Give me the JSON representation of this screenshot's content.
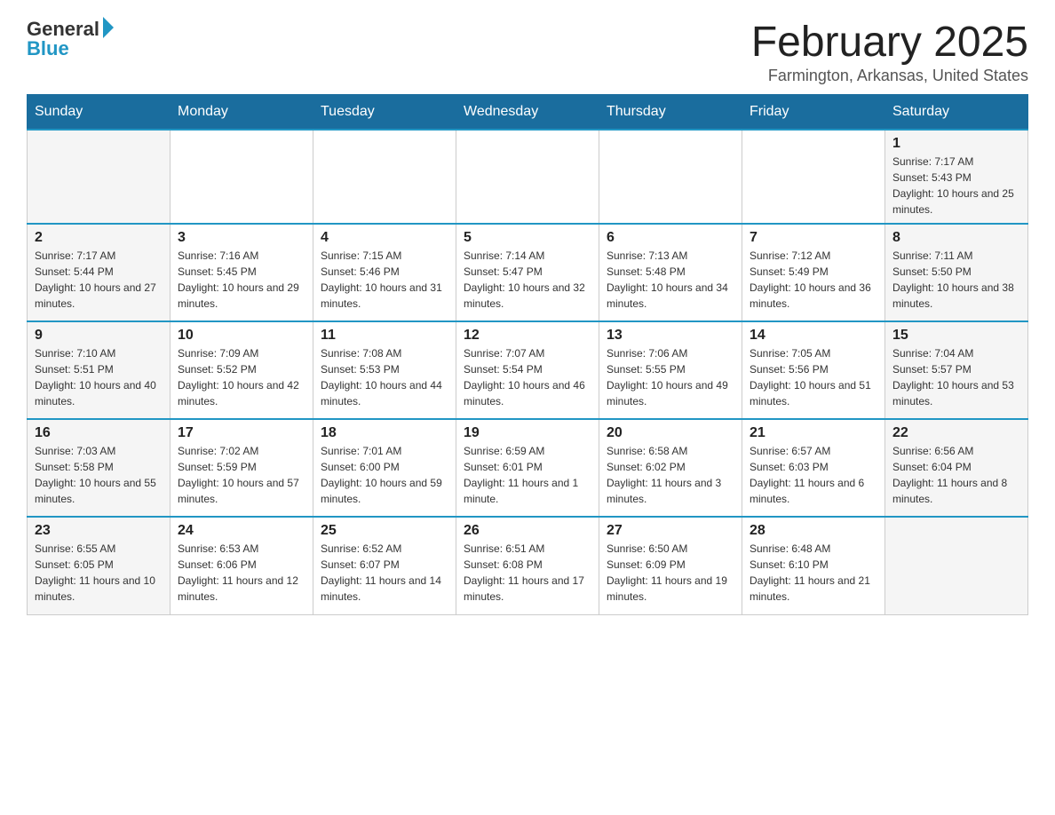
{
  "header": {
    "logo_general": "General",
    "logo_blue": "Blue",
    "month_title": "February 2025",
    "location": "Farmington, Arkansas, United States"
  },
  "days_of_week": [
    "Sunday",
    "Monday",
    "Tuesday",
    "Wednesday",
    "Thursday",
    "Friday",
    "Saturday"
  ],
  "weeks": [
    [
      {
        "day": "",
        "sunrise": "",
        "sunset": "",
        "daylight": ""
      },
      {
        "day": "",
        "sunrise": "",
        "sunset": "",
        "daylight": ""
      },
      {
        "day": "",
        "sunrise": "",
        "sunset": "",
        "daylight": ""
      },
      {
        "day": "",
        "sunrise": "",
        "sunset": "",
        "daylight": ""
      },
      {
        "day": "",
        "sunrise": "",
        "sunset": "",
        "daylight": ""
      },
      {
        "day": "",
        "sunrise": "",
        "sunset": "",
        "daylight": ""
      },
      {
        "day": "1",
        "sunrise": "Sunrise: 7:17 AM",
        "sunset": "Sunset: 5:43 PM",
        "daylight": "Daylight: 10 hours and 25 minutes."
      }
    ],
    [
      {
        "day": "2",
        "sunrise": "Sunrise: 7:17 AM",
        "sunset": "Sunset: 5:44 PM",
        "daylight": "Daylight: 10 hours and 27 minutes."
      },
      {
        "day": "3",
        "sunrise": "Sunrise: 7:16 AM",
        "sunset": "Sunset: 5:45 PM",
        "daylight": "Daylight: 10 hours and 29 minutes."
      },
      {
        "day": "4",
        "sunrise": "Sunrise: 7:15 AM",
        "sunset": "Sunset: 5:46 PM",
        "daylight": "Daylight: 10 hours and 31 minutes."
      },
      {
        "day": "5",
        "sunrise": "Sunrise: 7:14 AM",
        "sunset": "Sunset: 5:47 PM",
        "daylight": "Daylight: 10 hours and 32 minutes."
      },
      {
        "day": "6",
        "sunrise": "Sunrise: 7:13 AM",
        "sunset": "Sunset: 5:48 PM",
        "daylight": "Daylight: 10 hours and 34 minutes."
      },
      {
        "day": "7",
        "sunrise": "Sunrise: 7:12 AM",
        "sunset": "Sunset: 5:49 PM",
        "daylight": "Daylight: 10 hours and 36 minutes."
      },
      {
        "day": "8",
        "sunrise": "Sunrise: 7:11 AM",
        "sunset": "Sunset: 5:50 PM",
        "daylight": "Daylight: 10 hours and 38 minutes."
      }
    ],
    [
      {
        "day": "9",
        "sunrise": "Sunrise: 7:10 AM",
        "sunset": "Sunset: 5:51 PM",
        "daylight": "Daylight: 10 hours and 40 minutes."
      },
      {
        "day": "10",
        "sunrise": "Sunrise: 7:09 AM",
        "sunset": "Sunset: 5:52 PM",
        "daylight": "Daylight: 10 hours and 42 minutes."
      },
      {
        "day": "11",
        "sunrise": "Sunrise: 7:08 AM",
        "sunset": "Sunset: 5:53 PM",
        "daylight": "Daylight: 10 hours and 44 minutes."
      },
      {
        "day": "12",
        "sunrise": "Sunrise: 7:07 AM",
        "sunset": "Sunset: 5:54 PM",
        "daylight": "Daylight: 10 hours and 46 minutes."
      },
      {
        "day": "13",
        "sunrise": "Sunrise: 7:06 AM",
        "sunset": "Sunset: 5:55 PM",
        "daylight": "Daylight: 10 hours and 49 minutes."
      },
      {
        "day": "14",
        "sunrise": "Sunrise: 7:05 AM",
        "sunset": "Sunset: 5:56 PM",
        "daylight": "Daylight: 10 hours and 51 minutes."
      },
      {
        "day": "15",
        "sunrise": "Sunrise: 7:04 AM",
        "sunset": "Sunset: 5:57 PM",
        "daylight": "Daylight: 10 hours and 53 minutes."
      }
    ],
    [
      {
        "day": "16",
        "sunrise": "Sunrise: 7:03 AM",
        "sunset": "Sunset: 5:58 PM",
        "daylight": "Daylight: 10 hours and 55 minutes."
      },
      {
        "day": "17",
        "sunrise": "Sunrise: 7:02 AM",
        "sunset": "Sunset: 5:59 PM",
        "daylight": "Daylight: 10 hours and 57 minutes."
      },
      {
        "day": "18",
        "sunrise": "Sunrise: 7:01 AM",
        "sunset": "Sunset: 6:00 PM",
        "daylight": "Daylight: 10 hours and 59 minutes."
      },
      {
        "day": "19",
        "sunrise": "Sunrise: 6:59 AM",
        "sunset": "Sunset: 6:01 PM",
        "daylight": "Daylight: 11 hours and 1 minute."
      },
      {
        "day": "20",
        "sunrise": "Sunrise: 6:58 AM",
        "sunset": "Sunset: 6:02 PM",
        "daylight": "Daylight: 11 hours and 3 minutes."
      },
      {
        "day": "21",
        "sunrise": "Sunrise: 6:57 AM",
        "sunset": "Sunset: 6:03 PM",
        "daylight": "Daylight: 11 hours and 6 minutes."
      },
      {
        "day": "22",
        "sunrise": "Sunrise: 6:56 AM",
        "sunset": "Sunset: 6:04 PM",
        "daylight": "Daylight: 11 hours and 8 minutes."
      }
    ],
    [
      {
        "day": "23",
        "sunrise": "Sunrise: 6:55 AM",
        "sunset": "Sunset: 6:05 PM",
        "daylight": "Daylight: 11 hours and 10 minutes."
      },
      {
        "day": "24",
        "sunrise": "Sunrise: 6:53 AM",
        "sunset": "Sunset: 6:06 PM",
        "daylight": "Daylight: 11 hours and 12 minutes."
      },
      {
        "day": "25",
        "sunrise": "Sunrise: 6:52 AM",
        "sunset": "Sunset: 6:07 PM",
        "daylight": "Daylight: 11 hours and 14 minutes."
      },
      {
        "day": "26",
        "sunrise": "Sunrise: 6:51 AM",
        "sunset": "Sunset: 6:08 PM",
        "daylight": "Daylight: 11 hours and 17 minutes."
      },
      {
        "day": "27",
        "sunrise": "Sunrise: 6:50 AM",
        "sunset": "Sunset: 6:09 PM",
        "daylight": "Daylight: 11 hours and 19 minutes."
      },
      {
        "day": "28",
        "sunrise": "Sunrise: 6:48 AM",
        "sunset": "Sunset: 6:10 PM",
        "daylight": "Daylight: 11 hours and 21 minutes."
      },
      {
        "day": "",
        "sunrise": "",
        "sunset": "",
        "daylight": ""
      }
    ]
  ]
}
